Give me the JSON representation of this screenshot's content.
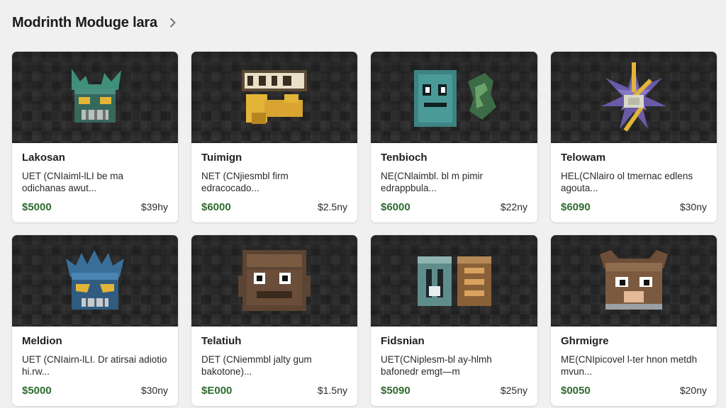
{
  "header": {
    "title": "Modrinth Moduge lara"
  },
  "icons": {
    "breadcrumb": "chevron-right-icon"
  },
  "colors": {
    "background": "#f0f0f0",
    "card": "#ffffff",
    "price": "#2e6b2f"
  },
  "cards": [
    {
      "name": "Lakosan",
      "desc": "UET (CNIaiml-lLI be ma odichanas awut...",
      "price": "$5000",
      "meta": "$39hy",
      "icon": "teal-creature-icon"
    },
    {
      "name": "Tuimign",
      "desc": "NET (CNjiesmbl firm edracocado...",
      "price": "$6000",
      "meta": "$2.5ny",
      "icon": "gold-block-icon"
    },
    {
      "name": "Tenbioch",
      "desc": "NE(CNlaimbl. bl m pimir edrappbula...",
      "price": "$6000",
      "meta": "$22ny",
      "icon": "teal-golem-icon"
    },
    {
      "name": "Telowam",
      "desc": "HEL(CNlairo ol tmernac edlens agouta...",
      "price": "$6090",
      "meta": "$30ny",
      "icon": "star-crystal-icon"
    },
    {
      "name": "Meldion",
      "desc": "UET (CNIairn-lLI. Dr atirsai adiotio hi.rw...",
      "price": "$5000",
      "meta": "$30ny",
      "icon": "blue-dragon-icon"
    },
    {
      "name": "Telatiuh",
      "desc": "DET (CNiemmbl jalty gum bakotone)...",
      "price": "$E000",
      "meta": "$1.5ny",
      "icon": "wood-golem-icon"
    },
    {
      "name": "Fidsnian",
      "desc": "UET(CNiplesm-bl ay-hlmh bafonedr emgt—m",
      "price": "$5090",
      "meta": "$25ny",
      "icon": "rune-blocks-icon"
    },
    {
      "name": "Ghrmigre",
      "desc": "ME(CNIpicovel l-ter hnon metdh mvun...",
      "price": "$0050",
      "meta": "$20ny",
      "icon": "brown-creature-icon"
    }
  ]
}
